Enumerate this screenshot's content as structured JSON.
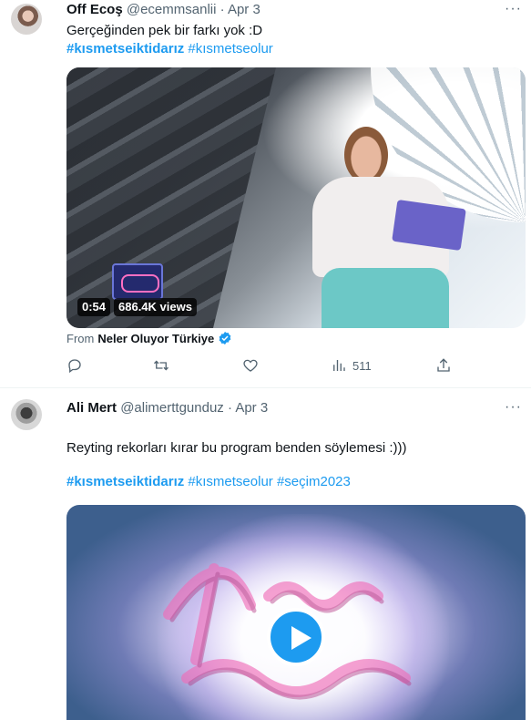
{
  "tweets": [
    {
      "author_name": "Off Ecoş",
      "handle": "@ecemmsanlii",
      "date": "· Apr 3",
      "more": "···",
      "text": "Gerçeğinden pek bir farkı yok :D",
      "hashtags": [
        {
          "text": "#kısmetseiktidarız",
          "bold": true
        },
        {
          "text": "#kısmetseolur",
          "bold": false
        }
      ],
      "media": {
        "duration": "0:54",
        "views": "686.4K views"
      },
      "from_label": "From",
      "from_source": "Neler Oluyor Türkiye",
      "actions": {
        "reply_count": "",
        "retweet_count": "",
        "like_count": "",
        "views_count": "511"
      }
    },
    {
      "author_name": "Ali Mert",
      "handle": "@alimerttgunduz",
      "date": "· Apr 3",
      "more": "···",
      "text": "Reyting rekorları kırar bu program benden söylemesi :)))",
      "hashtags": [
        {
          "text": "#kısmetseiktidarız",
          "bold": true
        },
        {
          "text": "#kısmetseolur",
          "bold": false
        },
        {
          "text": "#seçim2023",
          "bold": false
        }
      ]
    }
  ],
  "colors": {
    "accent": "#1d9bf0",
    "text_primary": "#0f1419",
    "text_secondary": "#536471"
  }
}
